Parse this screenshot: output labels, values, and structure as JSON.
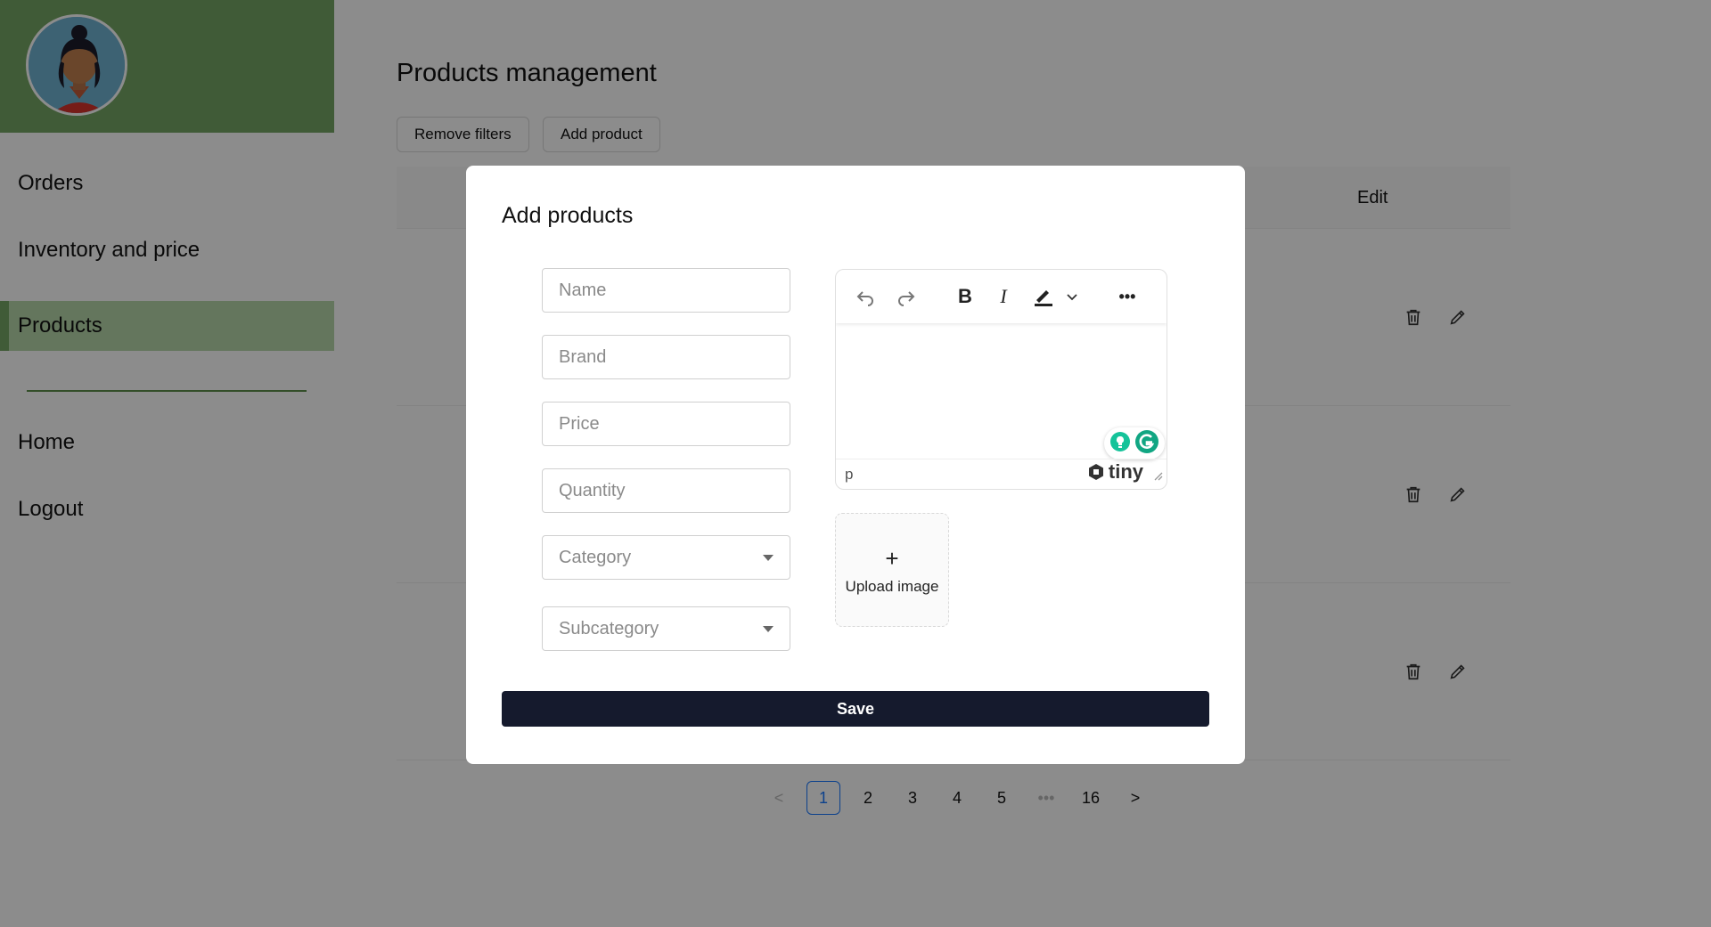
{
  "sidebar": {
    "nav": {
      "orders": "Orders",
      "inventory": "Inventory and price",
      "products": "Products",
      "home": "Home",
      "logout": "Logout"
    },
    "accent_color": "#76a765"
  },
  "main": {
    "title": "Products management",
    "buttons": {
      "remove_filters": "Remove filters",
      "add_product": "Add product"
    },
    "table": {
      "edit_header": "Edit"
    },
    "pagination": {
      "prev": "<",
      "pages": [
        "1",
        "2",
        "3",
        "4",
        "5"
      ],
      "ellipsis": "•••",
      "last": "16",
      "next": ">",
      "current": "1"
    }
  },
  "modal": {
    "title": "Add products",
    "fields": {
      "name_placeholder": "Name",
      "brand_placeholder": "Brand",
      "price_placeholder": "Price",
      "quantity_placeholder": "Quantity",
      "category_placeholder": "Category",
      "subcategory_placeholder": "Subcategory"
    },
    "editor": {
      "status_element": "p",
      "brand": "tiny",
      "toolbar_icons": [
        "undo-icon",
        "redo-icon",
        "bold-icon",
        "italic-icon",
        "highlight-icon",
        "more-icon"
      ],
      "bold_glyph": "B",
      "italic_glyph": "I",
      "more_glyph": "•••"
    },
    "upload": {
      "plus": "+",
      "label": "Upload image"
    },
    "save_label": "Save",
    "save_color": "#151a2d"
  }
}
